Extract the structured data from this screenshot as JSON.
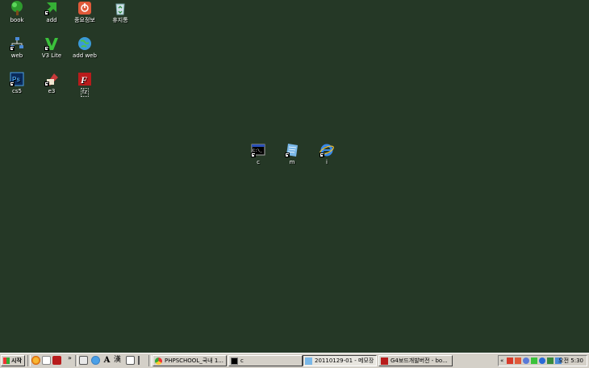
{
  "desktop": {
    "icons": [
      {
        "label": "book"
      },
      {
        "label": "add"
      },
      {
        "label": "종요정보"
      },
      {
        "label": "휴지통"
      },
      {
        "label": "web"
      },
      {
        "label": "V3 Lite"
      },
      {
        "label": "add web"
      },
      {
        "label": "cs5"
      },
      {
        "label": "e3"
      },
      {
        "label": "fz"
      },
      {
        "label": "c"
      },
      {
        "label": "m"
      },
      {
        "label": "i"
      }
    ]
  },
  "taskbar": {
    "start_label": "시작",
    "quicklaunch_more": "»",
    "tasks": [
      {
        "label": "PHPSCHOOL_국내 1..."
      },
      {
        "label": "c"
      },
      {
        "label": "20110129-01 - 메모장"
      },
      {
        "label": "G4보드개발버전 - bo..."
      }
    ],
    "tray": {
      "clock": "오전 5:30"
    }
  },
  "colors": {
    "desktop_bg": "#253826",
    "taskbar_bg": "#d4d0c8"
  }
}
